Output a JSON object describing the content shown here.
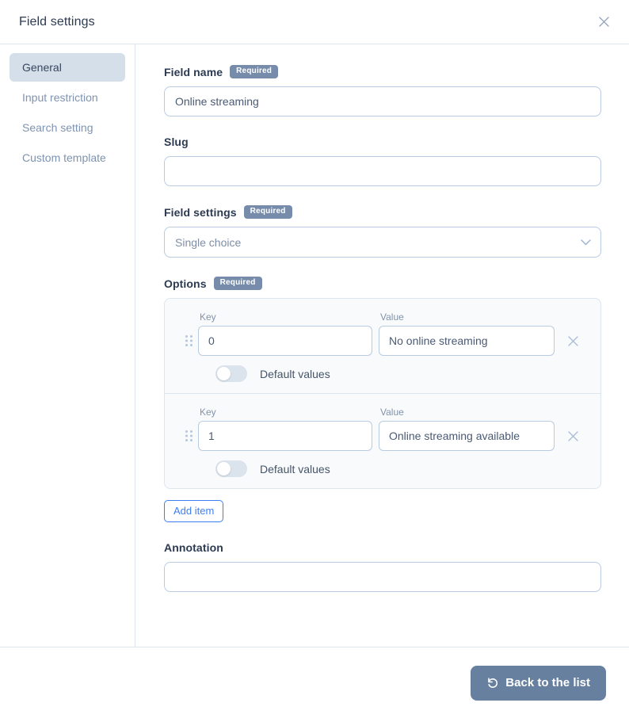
{
  "header": {
    "title": "Field settings",
    "close_label": "Close"
  },
  "sidebar": {
    "items": [
      {
        "label": "General",
        "active": true
      },
      {
        "label": "Input restriction",
        "active": false
      },
      {
        "label": "Search setting",
        "active": false
      },
      {
        "label": "Custom template",
        "active": false
      }
    ]
  },
  "form": {
    "badge_required": "Required",
    "field_name": {
      "label": "Field name",
      "value": "Online streaming",
      "placeholder": ""
    },
    "slug": {
      "label": "Slug",
      "value": "",
      "placeholder": ""
    },
    "field_settings": {
      "label": "Field settings",
      "selected": "Single choice",
      "options": [
        "Single choice"
      ]
    },
    "options": {
      "label": "Options",
      "key_label": "Key",
      "value_label": "Value",
      "toggle_label": "Default values",
      "add_item_label": "Add item",
      "items": [
        {
          "key": "0",
          "value": "No online streaming",
          "default_on": false
        },
        {
          "key": "1",
          "value": "Online streaming available",
          "default_on": false
        }
      ]
    },
    "annotation": {
      "label": "Annotation",
      "value": "",
      "placeholder": ""
    }
  },
  "footer": {
    "back_label": "Back to the list"
  },
  "colors": {
    "accent_blue": "#3d7ff2",
    "badge_slate": "#768caa",
    "button_slate": "#67809f",
    "border": "#dde5ef",
    "input_border": "#b9cbe0",
    "panel_bg": "#f8fafc",
    "active_nav_bg": "#d5dfea"
  }
}
